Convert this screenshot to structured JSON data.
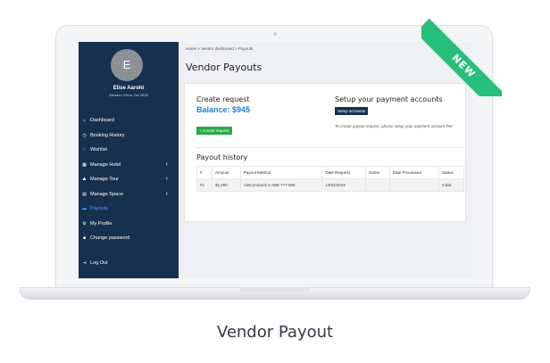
{
  "ribbon": "NEW",
  "user": {
    "avatar_letter": "E",
    "name": "Elise Aarohi",
    "since": "Member Since Oct 2018"
  },
  "sidebar": {
    "items": [
      {
        "label": "Dashboard",
        "icon": "home-icon"
      },
      {
        "label": "Booking History",
        "icon": "clock-icon"
      },
      {
        "label": "Wishlist",
        "icon": "heart-icon"
      },
      {
        "label": "Manage Hotel",
        "icon": "building-icon",
        "has_caret": true
      },
      {
        "label": "Manage Tour",
        "icon": "hiker-icon",
        "has_caret": true
      },
      {
        "label": "Manage Space",
        "icon": "space-icon",
        "has_caret": true
      },
      {
        "label": "Payouts",
        "icon": "dollar-icon",
        "active": true
      },
      {
        "label": "My Profile",
        "icon": "cogs-icon"
      },
      {
        "label": "Change password",
        "icon": "lock-icon"
      }
    ],
    "logout": "Log Out"
  },
  "breadcrumb": "Home > Vendor dashboard > Payouts",
  "page_title": "Vendor Payouts",
  "create": {
    "title": "Create request",
    "balance": "Balance: $945",
    "button": "+ Create request"
  },
  "setup": {
    "title": "Setup your payment accounts",
    "button": "Setup accounts",
    "note": "To create payout request, please setup your payment account first"
  },
  "history": {
    "title": "Payout history",
    "columns": [
      "#",
      "Amount",
      "Payout Method",
      "Date Request",
      "Notes",
      "Date Processed",
      "Status"
    ],
    "rows": [
      [
        "#1",
        "$1,890",
        "Vietcombank to 888-777-999",
        "10/04/2019",
        "",
        "",
        "Initial"
      ]
    ]
  },
  "caption": "Vendor Payout",
  "colors": {
    "sidebar": "#16304f",
    "accent": "#1a7fd6",
    "create_button": "#2aa84a",
    "ribbon": "#27c07a",
    "active_nav": "#4aa3ff"
  }
}
